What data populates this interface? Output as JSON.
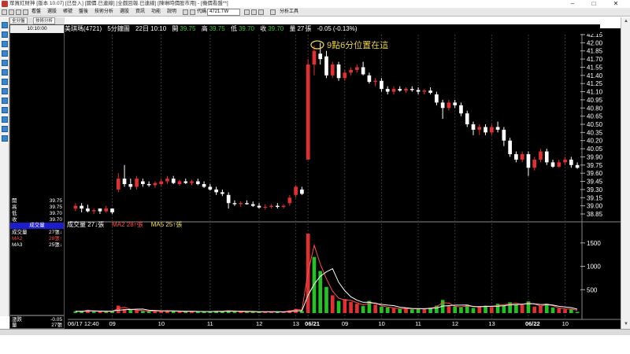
{
  "window": {
    "title": "眾買紅財神 [版本 10.07] [已登入] [國價.已連線] [全戲回報.已連線] [陳琳時價股市用] - [機價看盤**]",
    "controls": [
      "–",
      "□",
      "✕"
    ]
  },
  "toolbar": {
    "menus": [
      "看盤",
      "選股",
      "帳號",
      "盤後",
      "技術分析",
      "選股",
      "資訊",
      "功能",
      "說明"
    ],
    "code_label": "代碼",
    "symbol": "4721.TW",
    "analysis_label": "分析工具"
  },
  "left_tabs": [
    "全分盤",
    "技術分析"
  ],
  "left_panel": {
    "time": "10:10:00",
    "ohlc": [
      {
        "label": "開",
        "value": "39.75"
      },
      {
        "label": "高",
        "value": "39.75"
      },
      {
        "label": "低",
        "value": "39.70"
      },
      {
        "label": "收",
        "value": "39.70"
      }
    ],
    "volume_header": "成交量",
    "vol_rows": [
      {
        "label": "成交量",
        "value": "27張↓"
      },
      {
        "label": "MA2",
        "value": "28張↑"
      },
      {
        "label": "MA3",
        "value": "25張↓"
      }
    ],
    "bottom_rows": [
      {
        "label": "漲跌",
        "value": "-0.05"
      },
      {
        "label": "量",
        "value": "27張"
      }
    ]
  },
  "chart_header": {
    "name": "美琪瑪(4721)",
    "period": "5分鐘圖",
    "date_time": "22日 10:10",
    "open_label": "開",
    "open": "39.75",
    "high_label": "高",
    "high": "39.75",
    "low_label": "低",
    "low": "39.70",
    "close_label": "收",
    "close": "39.70",
    "vol_label": "量",
    "volume": "27",
    "vol_unit": "張",
    "change": "-0.05",
    "change_pct": "(-0.13%)"
  },
  "volume_header": {
    "vol": "成交量 27↓張",
    "ma2": "MA2 28↑張",
    "ma5": "MA5 25↑張"
  },
  "annotation": "9點6分位置在這",
  "colors": {
    "up": "#e23030",
    "down": "#ffffff",
    "vol_up": "#e23030",
    "vol_down": "#22c322",
    "vol_flat": "#aaaaaa",
    "annotation": "#e8d24c",
    "ma_white": "#ffffff",
    "ma_red": "#ff4d4d"
  },
  "chart_data": {
    "type": "candlestick",
    "price_ticks": [
      "42.15",
      "42.00",
      "41.85",
      "41.70",
      "41.55",
      "41.40",
      "41.25",
      "41.10",
      "40.95",
      "40.80",
      "40.65",
      "40.50",
      "40.35",
      "40.20",
      "40.05",
      "39.90",
      "39.75",
      "39.60",
      "39.45",
      "39.30",
      "39.15",
      "39.00",
      "38.85"
    ],
    "volume_ticks": [
      "1500",
      "1000",
      "500"
    ],
    "x_labels": [
      "06/17 12:40",
      "09",
      "10",
      "11",
      "12",
      "13",
      "06/21",
      "09",
      "10",
      "11",
      "12",
      "13",
      "06/22",
      "10"
    ],
    "candles": [
      [
        38.95,
        39.05,
        38.9,
        39.0
      ],
      [
        39.0,
        39.05,
        38.88,
        38.95
      ],
      [
        38.95,
        39.02,
        38.88,
        38.9
      ],
      [
        38.9,
        38.95,
        38.85,
        38.92
      ],
      [
        38.95,
        38.95,
        38.85,
        38.9
      ],
      [
        38.9,
        39.0,
        38.87,
        38.95
      ],
      [
        38.95,
        38.95,
        38.85,
        38.88
      ],
      [
        39.3,
        39.6,
        39.25,
        39.5
      ],
      [
        39.5,
        39.75,
        39.35,
        39.4
      ],
      [
        39.4,
        39.5,
        39.3,
        39.35
      ],
      [
        39.35,
        39.55,
        39.3,
        39.5
      ],
      [
        39.45,
        39.5,
        39.35,
        39.4
      ],
      [
        39.4,
        39.45,
        39.35,
        39.38
      ],
      [
        39.38,
        39.45,
        39.33,
        39.42
      ],
      [
        39.4,
        39.5,
        39.36,
        39.45
      ],
      [
        39.45,
        39.55,
        39.4,
        39.5
      ],
      [
        39.5,
        39.55,
        39.4,
        39.42
      ],
      [
        39.4,
        39.48,
        39.37,
        39.45
      ],
      [
        39.45,
        39.5,
        39.4,
        39.42
      ],
      [
        39.42,
        39.48,
        39.38,
        39.45
      ],
      [
        39.45,
        39.5,
        39.38,
        39.4
      ],
      [
        39.4,
        39.45,
        39.33,
        39.35
      ],
      [
        39.35,
        39.4,
        39.28,
        39.3
      ],
      [
        39.3,
        39.35,
        39.2,
        39.25
      ],
      [
        39.25,
        39.3,
        39.18,
        39.22
      ],
      [
        39.2,
        39.25,
        38.95,
        39.05
      ],
      [
        39.05,
        39.1,
        39.0,
        39.03
      ],
      [
        39.03,
        39.08,
        38.98,
        39.05
      ],
      [
        39.05,
        39.1,
        39.02,
        39.03
      ],
      [
        39.03,
        39.08,
        38.98,
        39.0
      ],
      [
        39.0,
        39.05,
        38.95,
        38.97
      ],
      [
        38.97,
        39.03,
        38.93,
        38.98
      ],
      [
        38.98,
        39.03,
        38.95,
        39.0
      ],
      [
        39.0,
        39.05,
        38.95,
        38.98
      ],
      [
        38.98,
        39.03,
        38.95,
        39.0
      ],
      [
        39.05,
        39.2,
        39.0,
        39.15
      ],
      [
        39.2,
        39.38,
        39.15,
        39.35
      ],
      [
        39.3,
        39.35,
        39.2,
        39.22
      ],
      [
        39.85,
        41.7,
        39.85,
        41.6
      ],
      [
        41.6,
        41.95,
        41.4,
        41.85
      ],
      [
        41.8,
        42.0,
        41.6,
        41.7
      ],
      [
        41.75,
        41.85,
        41.35,
        41.4
      ],
      [
        41.4,
        41.65,
        41.35,
        41.6
      ],
      [
        41.6,
        41.65,
        41.3,
        41.35
      ],
      [
        41.35,
        41.5,
        41.3,
        41.45
      ],
      [
        41.45,
        41.55,
        41.4,
        41.5
      ],
      [
        41.5,
        41.6,
        41.45,
        41.55
      ],
      [
        41.55,
        41.65,
        41.4,
        41.42
      ],
      [
        41.4,
        41.45,
        41.25,
        41.28
      ],
      [
        41.28,
        41.35,
        41.2,
        41.3
      ],
      [
        41.3,
        41.35,
        41.1,
        41.15
      ],
      [
        41.15,
        41.2,
        41.05,
        41.1
      ],
      [
        41.1,
        41.2,
        41.05,
        41.15
      ],
      [
        41.15,
        41.2,
        41.1,
        41.12
      ],
      [
        41.12,
        41.18,
        41.08,
        41.15
      ],
      [
        41.15,
        41.2,
        41.1,
        41.13
      ],
      [
        41.13,
        41.18,
        41.05,
        41.1
      ],
      [
        41.1,
        41.15,
        41.05,
        41.12
      ],
      [
        41.12,
        41.18,
        41.05,
        41.08
      ],
      [
        41.05,
        41.1,
        40.85,
        40.9
      ],
      [
        40.9,
        40.95,
        40.6,
        40.8
      ],
      [
        40.8,
        40.95,
        40.75,
        40.9
      ],
      [
        40.9,
        40.95,
        40.8,
        40.85
      ],
      [
        40.85,
        40.9,
        40.65,
        40.7
      ],
      [
        40.7,
        40.75,
        40.45,
        40.5
      ],
      [
        40.5,
        40.55,
        40.3,
        40.4
      ],
      [
        40.4,
        40.5,
        40.3,
        40.45
      ],
      [
        40.45,
        40.5,
        40.3,
        40.35
      ],
      [
        40.35,
        40.5,
        40.3,
        40.45
      ],
      [
        40.45,
        40.55,
        40.35,
        40.4
      ],
      [
        40.4,
        40.45,
        40.1,
        40.2
      ],
      [
        40.2,
        40.25,
        39.9,
        39.95
      ],
      [
        39.95,
        40.0,
        39.8,
        39.85
      ],
      [
        39.85,
        40.0,
        39.8,
        39.95
      ],
      [
        39.95,
        40.0,
        39.55,
        39.7
      ],
      [
        39.7,
        39.9,
        39.65,
        39.85
      ],
      [
        39.85,
        40.05,
        39.8,
        40.0
      ],
      [
        40.0,
        40.05,
        39.75,
        39.8
      ],
      [
        39.8,
        39.85,
        39.7,
        39.72
      ],
      [
        39.72,
        39.85,
        39.7,
        39.8
      ],
      [
        39.8,
        39.9,
        39.75,
        39.85
      ],
      [
        39.85,
        39.9,
        39.7,
        39.75
      ],
      [
        39.75,
        39.8,
        39.68,
        39.7
      ]
    ],
    "volumes": [
      40,
      35,
      70,
      30,
      45,
      30,
      40,
      160,
      90,
      70,
      60,
      45,
      40,
      50,
      45,
      55,
      40,
      30,
      35,
      40,
      30,
      35,
      30,
      45,
      40,
      60,
      30,
      25,
      35,
      30,
      25,
      30,
      25,
      30,
      25,
      60,
      90,
      45,
      1700,
      1200,
      900,
      560,
      380,
      260,
      300,
      240,
      200,
      150,
      260,
      180,
      140,
      120,
      100,
      90,
      110,
      80,
      100,
      90,
      120,
      160,
      280,
      150,
      140,
      120,
      180,
      110,
      140,
      160,
      130,
      200,
      160,
      230,
      190,
      180,
      250,
      140,
      160,
      200,
      120,
      100,
      80,
      90,
      27
    ],
    "vol_colors": [
      "d",
      "d",
      "u",
      "d",
      "u",
      "d",
      "d",
      "u",
      "u",
      "d",
      "u",
      "d",
      "d",
      "u",
      "u",
      "u",
      "d",
      "u",
      "d",
      "u",
      "d",
      "d",
      "d",
      "d",
      "d",
      "d",
      "d",
      "u",
      "d",
      "d",
      "d",
      "u",
      "u",
      "d",
      "u",
      "u",
      "u",
      "d",
      "u",
      "d",
      "d",
      "d",
      "u",
      "d",
      "u",
      "u",
      "u",
      "d",
      "d",
      "u",
      "d",
      "d",
      "u",
      "d",
      "u",
      "d",
      "d",
      "u",
      "d",
      "d",
      "d",
      "u",
      "d",
      "d",
      "d",
      "d",
      "u",
      "d",
      "u",
      "d",
      "d",
      "d",
      "d",
      "u",
      "d",
      "u",
      "u",
      "d",
      "d",
      "u",
      "u",
      "d",
      "d"
    ]
  }
}
